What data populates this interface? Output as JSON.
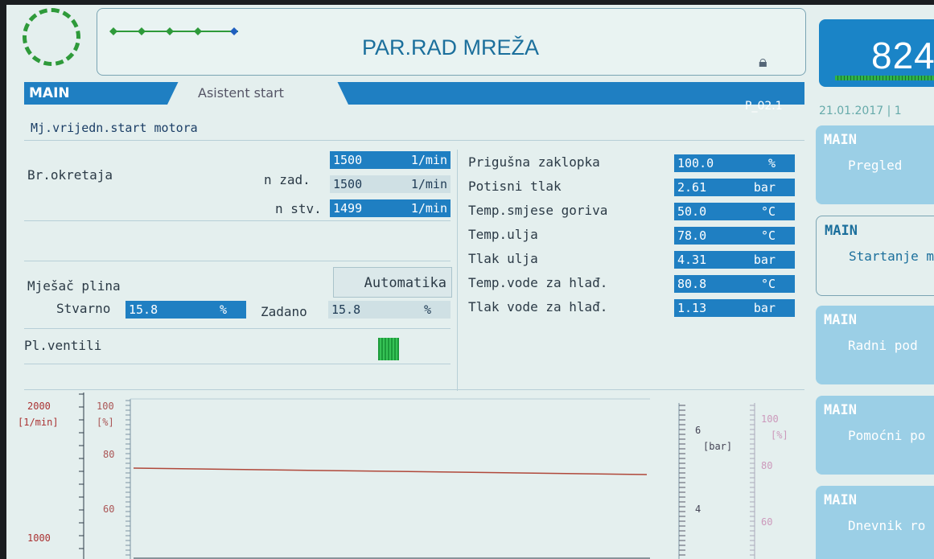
{
  "header": {
    "title": "PAR.RAD MREŽA",
    "counter": "824",
    "date": "21.01.2017 | 1"
  },
  "tabs": {
    "active": "MAIN",
    "inactive": "Asistent start",
    "code": "P_02.1"
  },
  "subtitle": "Mj.vrijedn.start motora",
  "speed": {
    "label": "Br.okretaja",
    "rows": [
      {
        "label": "",
        "value": "1500",
        "unit": "1/min"
      },
      {
        "label": "n zad.",
        "value": "1500",
        "unit": "1/min"
      },
      {
        "label": "n stv.",
        "value": "1499",
        "unit": "1/min"
      }
    ]
  },
  "mixer": {
    "label": "Mješač plina",
    "mode": "Automatika",
    "actual_label": "Stvarno",
    "actual_value": "15.8",
    "actual_unit": "%",
    "set_label": "Zadano",
    "set_value": "15.8",
    "set_unit": "%"
  },
  "valves": {
    "label": "Pl.ventili"
  },
  "params": [
    {
      "label": "Prigušna zaklopka",
      "value": "100.0",
      "unit": "%"
    },
    {
      "label": "Potisni tlak",
      "value": "2.61",
      "unit": "bar"
    },
    {
      "label": "Temp.smjese goriva",
      "value": "50.0",
      "unit": "°C"
    },
    {
      "label": "Temp.ulja",
      "value": "78.0",
      "unit": "°C"
    },
    {
      "label": "Tlak ulja",
      "value": "4.31",
      "unit": "bar"
    },
    {
      "label": "Temp.vode za hlađ.",
      "value": "80.8",
      "unit": "°C"
    },
    {
      "label": "Tlak vode za hlađ.",
      "value": "1.13",
      "unit": "bar"
    }
  ],
  "sidebar": [
    {
      "h": "MAIN",
      "t": "Pregled"
    },
    {
      "h": "MAIN",
      "t": "Startanje m"
    },
    {
      "h": "MAIN",
      "t": "Radni pod"
    },
    {
      "h": "MAIN",
      "t": "Pomoćni po"
    },
    {
      "h": "MAIN",
      "t": "Dnevnik ro"
    }
  ],
  "chart": {
    "left_axis1": {
      "ticks": [
        "2000",
        "1000"
      ],
      "unit": "[1/min]"
    },
    "left_axis2": {
      "ticks": [
        "100",
        "80",
        "60"
      ],
      "unit": "[%]"
    },
    "right_axis1": {
      "ticks": [
        "6",
        "4"
      ],
      "unit": "[bar]"
    },
    "right_axis2": {
      "ticks": [
        "100",
        "80",
        "60"
      ],
      "unit": "[%]"
    }
  },
  "colors": {
    "accent": "#1f7fc2",
    "background": "#e4efee",
    "ok_green": "#2e9a3a",
    "trend_line": "#b0483a"
  }
}
